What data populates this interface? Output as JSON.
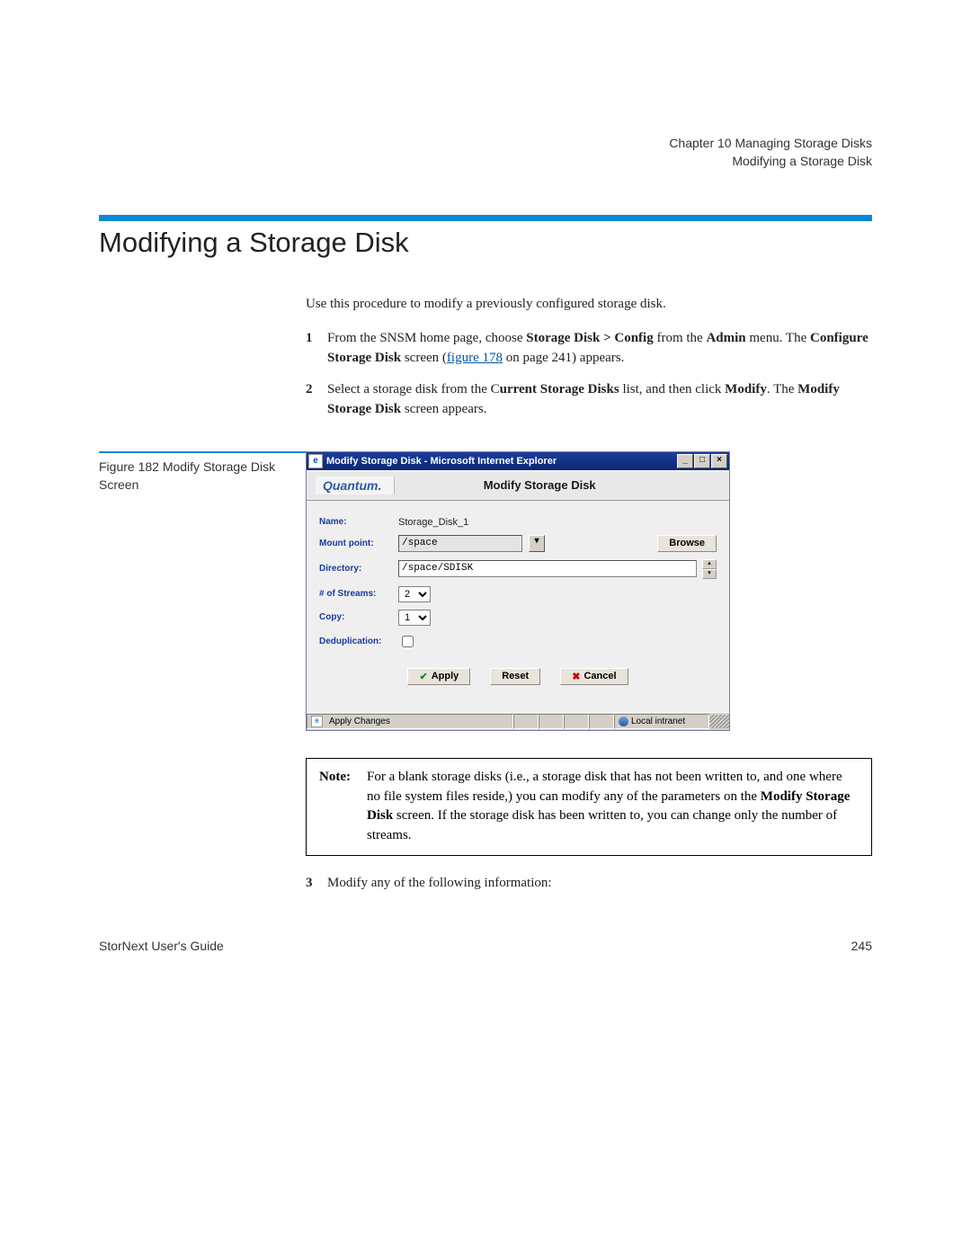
{
  "header": {
    "chapter_line": "Chapter 10  Managing Storage Disks",
    "section_line": "Modifying a Storage Disk"
  },
  "title": "Modifying a Storage Disk",
  "intro": "Use this procedure to modify a previously configured storage disk.",
  "step1": {
    "num": "1",
    "pre": "From the SNSM home page, choose ",
    "b1": "Storage Disk > Config",
    "mid1": " from the ",
    "b2": "Admin",
    "mid2": " menu. The ",
    "b3": "Configure Storage Disk",
    "mid3": " screen (",
    "link": "figure 178",
    "post": " on page 241) appears."
  },
  "step2": {
    "num": "2",
    "pre": "Select a storage disk from the C",
    "b1": "urrent Storage Disks",
    "mid1": " list, and then click ",
    "b2": "Modify",
    "mid2": ". The ",
    "b3": "Modify Storage Disk",
    "post": " screen appears."
  },
  "figure": {
    "caption": "Figure 182  Modify Storage Disk Screen",
    "window_title": "Modify Storage Disk - Microsoft Internet Explorer",
    "brand": "Quantum.",
    "app_title": "Modify Storage Disk",
    "labels": {
      "name": "Name:",
      "mount": "Mount point:",
      "directory": "Directory:",
      "streams": "# of Streams:",
      "copy": "Copy:",
      "dedup": "Deduplication:"
    },
    "values": {
      "name": "Storage_Disk_1",
      "mount": "/space",
      "directory": "/space/SDISK",
      "streams": "2",
      "copy": "1"
    },
    "buttons": {
      "browse": "Browse",
      "apply": "Apply",
      "reset": "Reset",
      "cancel": "Cancel"
    },
    "status": {
      "left": "Apply Changes",
      "zone": "Local intranet"
    }
  },
  "note": {
    "label": "Note:",
    "pre": "For a blank storage disks (i.e., a storage disk that has not been written to, and one where no file system files reside,) you can modify any of the parameters on the ",
    "b1": "Modify Storage Disk",
    "post": " screen. If the storage disk has been written to, you can change only the number of streams."
  },
  "step3": {
    "num": "3",
    "text": "Modify any of the following information:"
  },
  "footer": {
    "left": "StorNext User's Guide",
    "right": "245"
  }
}
